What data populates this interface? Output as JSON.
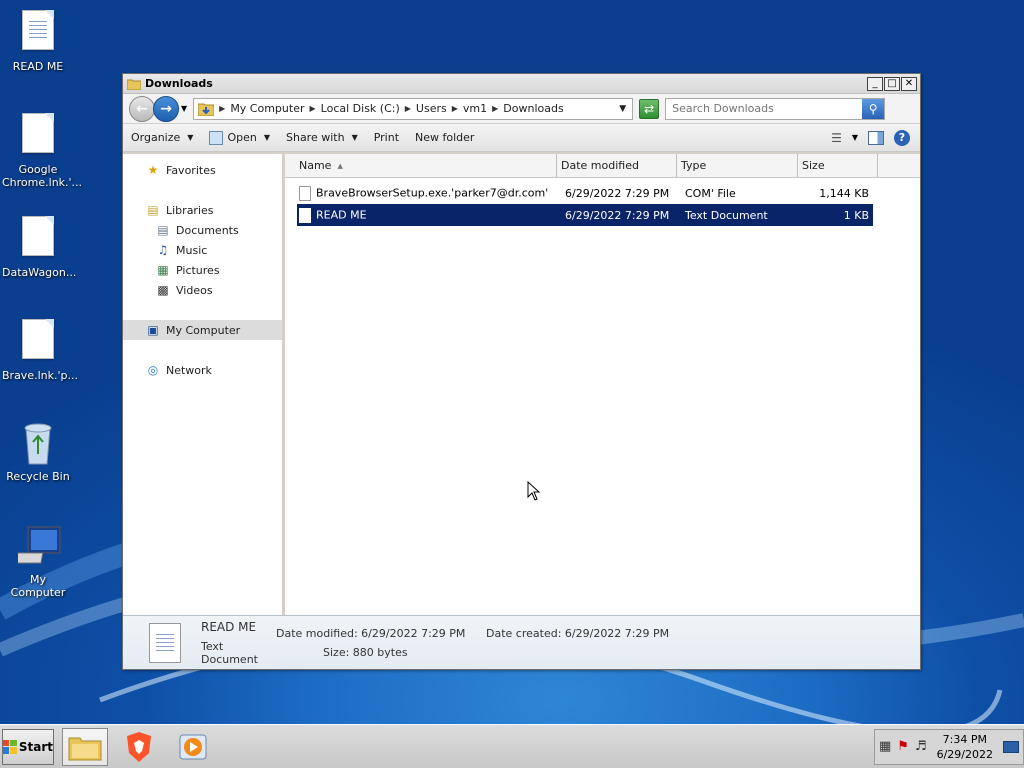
{
  "desktop": {
    "icons": [
      {
        "label": "READ ME",
        "icon": "text-file-icon"
      },
      {
        "label": "Google Chrome.lnk.'...",
        "icon": "file-icon"
      },
      {
        "label": "DataWagon...",
        "icon": "file-icon"
      },
      {
        "label": "Brave.lnk.'p...",
        "icon": "file-icon"
      },
      {
        "label": "Recycle Bin",
        "icon": "recycle-bin-icon"
      },
      {
        "label": "My Computer",
        "icon": "computer-icon"
      }
    ]
  },
  "window": {
    "title": "Downloads",
    "buttons": {
      "minimize": "_",
      "maximize": "□",
      "close": "✕"
    }
  },
  "address": {
    "crumbs": [
      "My Computer",
      "Local Disk (C:)",
      "Users",
      "vm1",
      "Downloads"
    ]
  },
  "search": {
    "placeholder": "Search Downloads"
  },
  "toolbar": {
    "organize": "Organize",
    "open": "Open",
    "share_with": "Share with",
    "print": "Print",
    "new_folder": "New folder"
  },
  "nav": {
    "favorites": "Favorites",
    "libraries": "Libraries",
    "documents": "Documents",
    "music": "Music",
    "pictures": "Pictures",
    "videos": "Videos",
    "my_computer": "My Computer",
    "network": "Network"
  },
  "table": {
    "headers": {
      "name": "Name",
      "date": "Date modified",
      "type": "Type",
      "size": "Size"
    },
    "rows": [
      {
        "name": "BraveBrowserSetup.exe.'parker7@dr.com'",
        "date": "6/29/2022 7:29 PM",
        "type": "COM' File",
        "size": "1,144 KB"
      },
      {
        "name": "READ ME",
        "date": "6/29/2022 7:29 PM",
        "type": "Text Document",
        "size": "1 KB"
      }
    ]
  },
  "details": {
    "name": "READ ME",
    "type": "Text Document",
    "date_modified_label": "Date modified:",
    "date_modified": "6/29/2022 7:29 PM",
    "size_label": "Size:",
    "size": "880 bytes",
    "date_created_label": "Date created:",
    "date_created": "6/29/2022 7:29 PM"
  },
  "taskbar": {
    "start": "Start",
    "time": "7:34 PM",
    "date": "6/29/2022"
  }
}
